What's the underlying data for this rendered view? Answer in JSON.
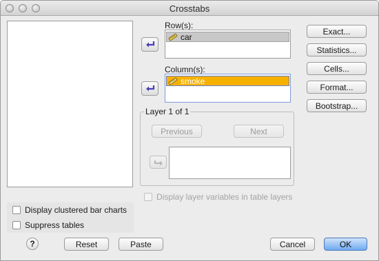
{
  "window": {
    "title": "Crosstabs"
  },
  "rows": {
    "label": "Row(s):",
    "items": [
      {
        "label": "car",
        "icon": "ruler-icon"
      }
    ]
  },
  "columns": {
    "label": "Column(s):",
    "items": [
      {
        "label": "smoke",
        "icon": "ruler-icon"
      }
    ]
  },
  "layer": {
    "title": "Layer 1 of 1",
    "previous_label": "Previous",
    "next_label": "Next"
  },
  "side_buttons": {
    "exact": "Exact...",
    "statistics": "Statistics...",
    "cells": "Cells...",
    "format": "Format...",
    "bootstrap": "Bootstrap..."
  },
  "options": {
    "display_layer_vars": "Display layer variables in table layers",
    "clustered_bar": "Display clustered bar charts",
    "suppress_tables": "Suppress tables"
  },
  "bottom": {
    "help": "?",
    "reset": "Reset",
    "paste": "Paste",
    "cancel": "Cancel",
    "ok": "OK"
  },
  "colors": {
    "selected_item": "#f6b100",
    "ok_button": "#6faaf0"
  }
}
